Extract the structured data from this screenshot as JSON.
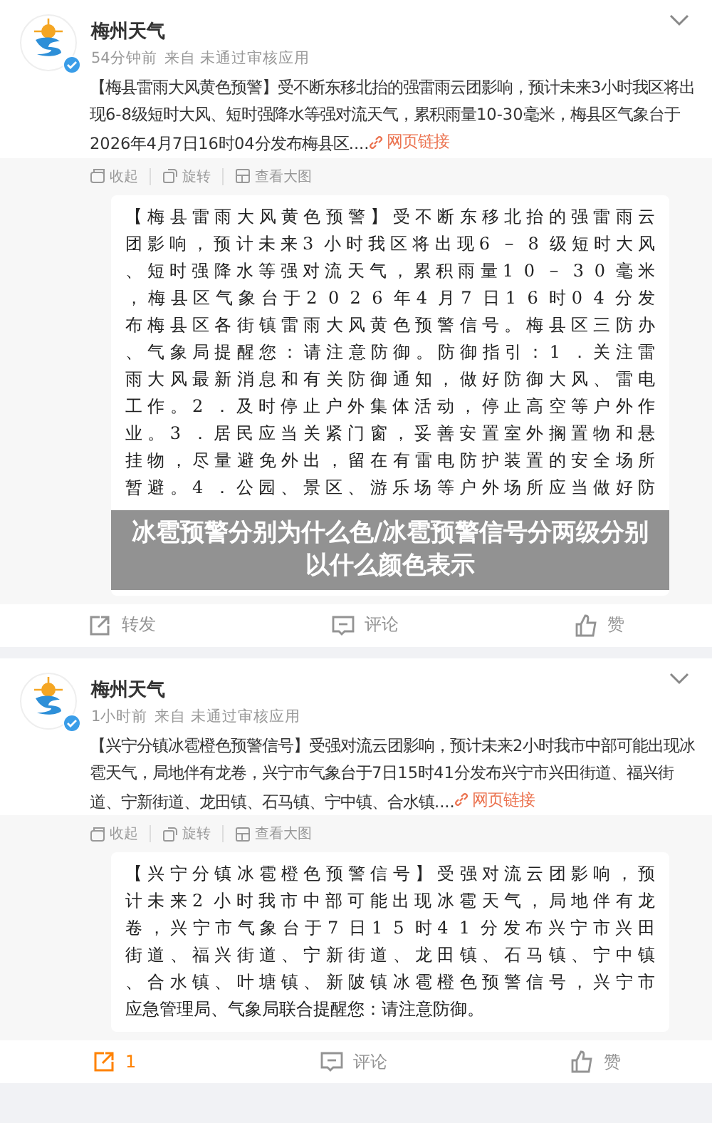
{
  "posts": [
    {
      "author": "梅州天气",
      "verified": true,
      "time": "54分钟前",
      "source": "来自 未通过审核应用",
      "text": "【梅县雷雨大风黄色预警】受不断东移北抬的强雷雨云团影响，预计未来3小时我区将出现6-8级短时大风、短时强降水等强对流天气，累积雨量10-30毫米，梅县区气象台于2026年4月7日16时04分发布梅县区....",
      "link": "网页链接",
      "image_tools": [
        "收起",
        "旋转",
        "查看大图"
      ],
      "image_lines": [
        "【梅县雷雨大风黄色预警】受不断东移北抬的强雷雨云",
        "团影响，预计未来3 小时我区将出现6 － 8 级短时大风",
        "、短时强降水等强对流天气，累积雨量1 0 － 3 0 毫米",
        "，梅县区气象台于2 0 2 6 年4 月7 日1 6 时0 4 分发",
        "布梅县区各街镇雷雨大风黄色预警信号。梅县区三防办",
        "、气象局提醒您：请注意防御。防御指引：1 ．关注雷",
        "雨大风最新消息和有关防御通知，做好防御大风、雷电",
        "工作。2 ．及时停止户外集体活动，停止高空等户外作",
        "业。3 ．居民应当关紧门窗，妥善安置室外搁置物和悬",
        "挂物，尽量避免外出，留在有雷电防护装置的安全场所",
        "暂避。4 ．公园、景区、游乐场等户外场所应当做好防"
      ],
      "overlay_caption": "冰雹预警分别为什么色/冰雹预警信号分两级分别以什么颜色表示",
      "actions": [
        {
          "kind": "repost",
          "label": "转发",
          "highlighted": false
        },
        {
          "kind": "comment",
          "label": "评论",
          "highlighted": false
        },
        {
          "kind": "like",
          "label": "赞",
          "highlighted": false
        }
      ]
    },
    {
      "author": "梅州天气",
      "verified": true,
      "time": "1小时前",
      "source": "来自 未通过审核应用",
      "text": "【兴宁分镇冰雹橙色预警信号】受强对流云团影响，预计未来2小时我市中部可能出现冰雹天气，局地伴有龙卷，兴宁市气象台于7日15时41分发布兴宁市兴田街道、福兴街道、宁新街道、龙田镇、石马镇、宁中镇、合水镇....",
      "link": "网页链接",
      "image_tools": [
        "收起",
        "旋转",
        "查看大图"
      ],
      "image_lines": [
        "【兴宁分镇冰雹橙色预警信号】受强对流云团影响，预",
        "计未来2 小时我市中部可能出现冰雹天气，局地伴有龙",
        "卷，兴宁市气象台于7 日1 5 时4 1 分发布兴宁市兴田",
        "街道、福兴街道、宁新街道、龙田镇、石马镇、宁中镇",
        "、合水镇、叶塘镇、新陂镇冰雹橙色预警信号，兴宁市",
        "应急管理局、气象局联合提醒您：请注意防御。"
      ],
      "actions": [
        {
          "kind": "repost",
          "label": "1",
          "highlighted": true
        },
        {
          "kind": "comment",
          "label": "评论",
          "highlighted": false
        },
        {
          "kind": "like",
          "label": "赞",
          "highlighted": false
        }
      ]
    }
  ]
}
